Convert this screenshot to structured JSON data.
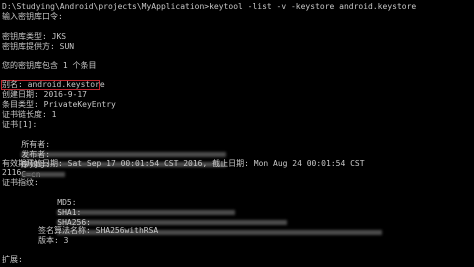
{
  "terminal": {
    "command_line": "D:\\Studying\\Android\\projects\\MyApplication>keytool -list -v -keystore android.keystore",
    "prompt_password": "输入密钥库口令:",
    "keystore_type": "密钥库类型: JKS",
    "keystore_provider": "密钥库提供方: SUN",
    "entry_count": "您的密钥库包含 1 个条目",
    "alias": "别名: android.keystore",
    "created": "创建日期: 2016-9-17",
    "entry_type": "条目类型: PrivateKeyEntry",
    "chain_length": "证书链长度: 1",
    "cert_index": "证书[1]:",
    "owner_label": "所有者:",
    "owner_suffix": "C=cn",
    "issuer_label": "发布者:",
    "issuer_suffix": "C=cn",
    "serial_label": "序列号:",
    "validity": "有效期开始日期: Sat Sep 17 00:01:54 CST 2016, 截止日期: Mon Aug 24 00:01:54 CST",
    "validity_cont": "2116",
    "fingerprint_label": "证书指纹:",
    "md5": "MD5:",
    "sha1": "SHA1:",
    "sha256": "SHA256:",
    "sig_alg": "签名算法名称: SHA256withRSA",
    "version": "版本: 3",
    "extensions": "扩展:"
  }
}
